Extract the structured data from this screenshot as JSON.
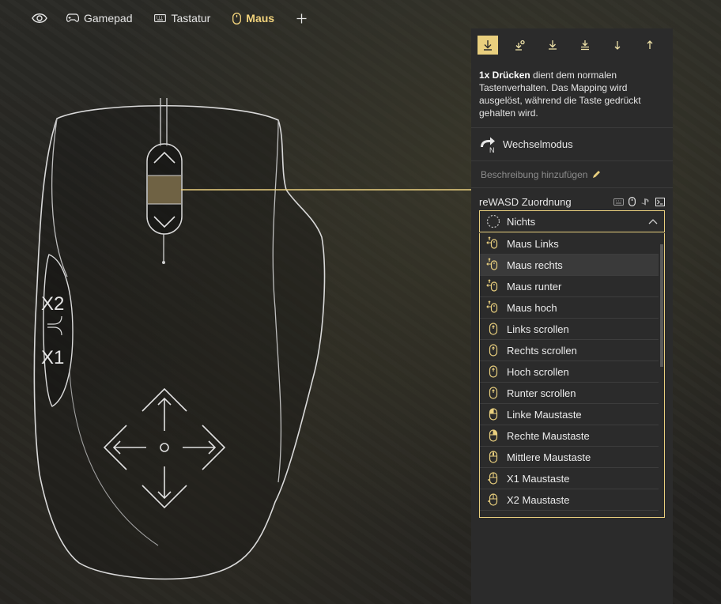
{
  "tabs": [
    {
      "label": "Gamepad",
      "icon": "gamepad-icon"
    },
    {
      "label": "Tastatur",
      "icon": "keyboard-icon"
    },
    {
      "label": "Maus",
      "icon": "mouse-icon",
      "active": true
    }
  ],
  "mouse": {
    "x2_label": "X2",
    "x1_label": "X1"
  },
  "panel": {
    "description_bold": "1x Drücken",
    "description_rest": " dient dem normalen Tastenverhalten. Das Mapping wird ausgelöst, während die Taste gedrückt gehalten wird.",
    "toggle_label": "Wechselmodus",
    "toggle_badge": "N",
    "add_description": "Beschreibung hinzufügen",
    "mapping_title": "reWASD Zuordnung",
    "selected_value": "Nichts",
    "options": [
      {
        "label": "Maus Links",
        "icon": "mouse-move-left-icon"
      },
      {
        "label": "Maus rechts",
        "icon": "mouse-move-right-icon"
      },
      {
        "label": "Maus runter",
        "icon": "mouse-move-down-icon"
      },
      {
        "label": "Maus hoch",
        "icon": "mouse-move-up-icon"
      },
      {
        "label": "Links scrollen",
        "icon": "scroll-left-icon"
      },
      {
        "label": "Rechts scrollen",
        "icon": "scroll-right-icon"
      },
      {
        "label": "Hoch scrollen",
        "icon": "scroll-up-icon"
      },
      {
        "label": "Runter scrollen",
        "icon": "scroll-down-icon"
      },
      {
        "label": "Linke Maustaste",
        "icon": "left-mouse-button-icon"
      },
      {
        "label": "Rechte Maustaste",
        "icon": "right-mouse-button-icon"
      },
      {
        "label": "Mittlere Maustaste",
        "icon": "middle-mouse-button-icon"
      },
      {
        "label": "X1 Maustaste",
        "icon": "x1-mouse-button-icon"
      },
      {
        "label": "X2 Maustaste",
        "icon": "x2-mouse-button-icon"
      }
    ],
    "hovered_option": "Maus rechts"
  },
  "colors": {
    "accent": "#e9cf7e",
    "panel_bg": "#2b2b2b",
    "selected_zone": "#6f6244"
  }
}
